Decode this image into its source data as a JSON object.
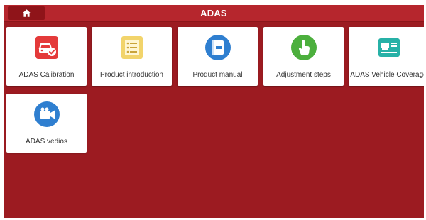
{
  "header": {
    "title": "ADAS",
    "home_icon": "home-icon"
  },
  "tiles": [
    {
      "label": "ADAS Calibration",
      "icon": "car-check-icon",
      "color": "#e43a3a"
    },
    {
      "label": "Product introduction",
      "icon": "list-icon",
      "color": "#f2d46b"
    },
    {
      "label": "Product manual",
      "icon": "manual-book-icon",
      "color": "#2f7fd0"
    },
    {
      "label": "Adjustment steps",
      "icon": "touch-hand-icon",
      "color": "#4caf3d"
    },
    {
      "label": "ADAS Vehicle Coverage",
      "icon": "vehicle-card-icon",
      "color": "#27b1a7"
    },
    {
      "label": "ADAS vedios",
      "icon": "video-camera-icon",
      "color": "#2f7fd0"
    }
  ],
  "colors": {
    "background": "#9c1b21",
    "header": "#b6262d",
    "home_button": "#8f1419"
  }
}
